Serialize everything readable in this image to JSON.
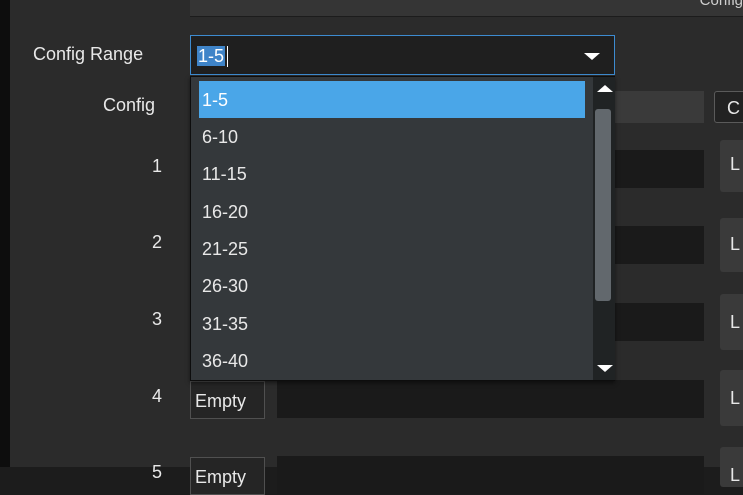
{
  "header": {
    "partial_label": "Config"
  },
  "config_range": {
    "label": "Config Range",
    "value": "1-5",
    "options": [
      "1-5",
      "6-10",
      "11-15",
      "16-20",
      "21-25",
      "26-30",
      "31-35",
      "36-40"
    ]
  },
  "config_header": {
    "label": "Config",
    "button_partial": "C"
  },
  "rows": [
    {
      "number": "1",
      "button_partial": "L"
    },
    {
      "number": "2",
      "button_partial": "L"
    },
    {
      "number": "3",
      "button_partial": "L"
    },
    {
      "number": "4",
      "slot_label": "Empty",
      "button_partial": "L"
    },
    {
      "number": "5",
      "slot_label": "Empty",
      "button_partial": "L"
    }
  ],
  "colors": {
    "accent": "#4aa6e8",
    "focus_border": "#3d8bd0",
    "panel_bg": "#2b2b2b",
    "dropdown_bg": "#34383b",
    "field_bg": "#1a1a1a"
  }
}
